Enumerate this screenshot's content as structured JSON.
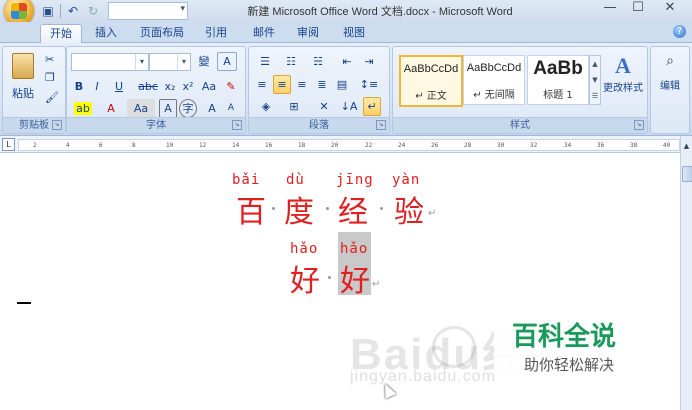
{
  "window": {
    "title": "新建 Microsoft Office Word 文档.docx - Microsoft Word"
  },
  "quick_access": {
    "icons": [
      "save-icon",
      "undo-icon",
      "redo-icon"
    ]
  },
  "tabs": [
    {
      "label": "开始",
      "active": true
    },
    {
      "label": "插入"
    },
    {
      "label": "页面布局"
    },
    {
      "label": "引用"
    },
    {
      "label": "邮件"
    },
    {
      "label": "审阅"
    },
    {
      "label": "视图"
    }
  ],
  "ribbon": {
    "clipboard": {
      "group_label": "剪贴板",
      "paste_label": "粘贴"
    },
    "font": {
      "group_label": "字体",
      "font_name": "",
      "font_size": "",
      "buttons": [
        "B",
        "I",
        "U",
        "abc",
        "x₂",
        "x²",
        "Aa",
        "A",
        "A",
        "A"
      ]
    },
    "paragraph": {
      "group_label": "段落"
    },
    "styles": {
      "group_label": "样式",
      "items": [
        {
          "sample": "AaBbCcDd",
          "name": "↵ 正文"
        },
        {
          "sample": "AaBbCcDd",
          "name": "↵ 无间隔"
        },
        {
          "sample": "AaBb",
          "name": "标题 1"
        }
      ],
      "change_styles_label": "更改样式"
    },
    "editing": {
      "label": "编辑"
    }
  },
  "ruler": {
    "ticks": [
      "2",
      "4",
      "6",
      "8",
      "10",
      "12",
      "14",
      "16",
      "18",
      "20",
      "22",
      "24",
      "26",
      "28",
      "30",
      "32",
      "34",
      "36",
      "38",
      "40"
    ]
  },
  "document": {
    "line1": {
      "pinyin": [
        "bǎi",
        "dù",
        "jīng",
        "yàn"
      ],
      "hanzi": [
        "百",
        "度",
        "经",
        "验"
      ]
    },
    "line2": {
      "pinyin": [
        "hǎo",
        "hǎo"
      ],
      "hanzi": [
        "好",
        "好"
      ]
    },
    "text_color": "#e02020"
  },
  "watermark": {
    "text": "Baidu经验",
    "url_text": "jingyan.baidu.com"
  },
  "brand": {
    "main": "百科全说",
    "sub": "助你轻松解决",
    "color": "#1a9a5a"
  }
}
